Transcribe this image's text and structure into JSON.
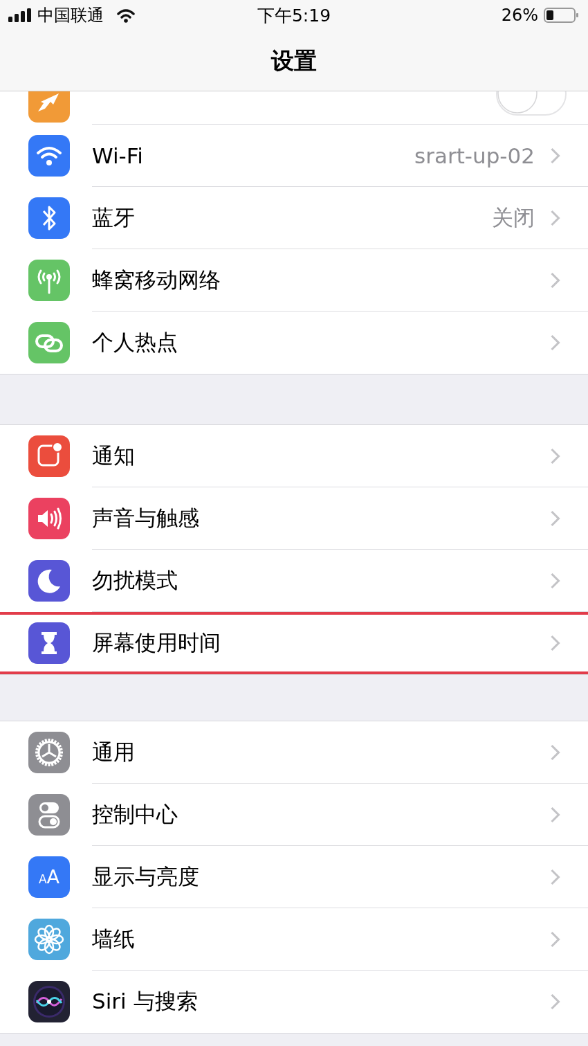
{
  "status_bar": {
    "carrier": "中国联通",
    "time": "下午5:19",
    "battery": "26%"
  },
  "nav": {
    "title": "设置"
  },
  "sections": [
    {
      "items": [
        {
          "kind": "toggle",
          "color": "#f19a37",
          "on": false
        },
        {
          "kind": "link",
          "label": "Wi-Fi",
          "value": "srart-up-02",
          "color": "#3478f6"
        },
        {
          "kind": "link",
          "label": "蓝牙",
          "value": "关闭",
          "color": "#3478f6"
        },
        {
          "kind": "link",
          "label": "蜂窝移动网络",
          "color": "#65c466"
        },
        {
          "kind": "link",
          "label": "个人热点",
          "color": "#65c466"
        }
      ]
    },
    {
      "items": [
        {
          "kind": "link",
          "label": "通知",
          "color": "#eb4d3d",
          "highlighted": false
        },
        {
          "kind": "link",
          "label": "声音与触感",
          "color": "#eb4160",
          "highlighted": false
        },
        {
          "kind": "link",
          "label": "勿扰模式",
          "color": "#5856d6",
          "highlighted": false
        },
        {
          "kind": "link",
          "label": "屏幕使用时间",
          "color": "#5856d6",
          "highlighted": true
        }
      ]
    },
    {
      "items": [
        {
          "kind": "link",
          "label": "通用",
          "color": "#8e8e93"
        },
        {
          "kind": "link",
          "label": "控制中心",
          "color": "#8e8e93"
        },
        {
          "kind": "link",
          "label": "显示与亮度",
          "color": "#3478f6",
          "icon_text": "AA"
        },
        {
          "kind": "link",
          "label": "墙纸",
          "color": "#4fa8dd"
        },
        {
          "kind": "link",
          "label": "Siri 与搜索",
          "color": "#222233"
        }
      ]
    }
  ]
}
